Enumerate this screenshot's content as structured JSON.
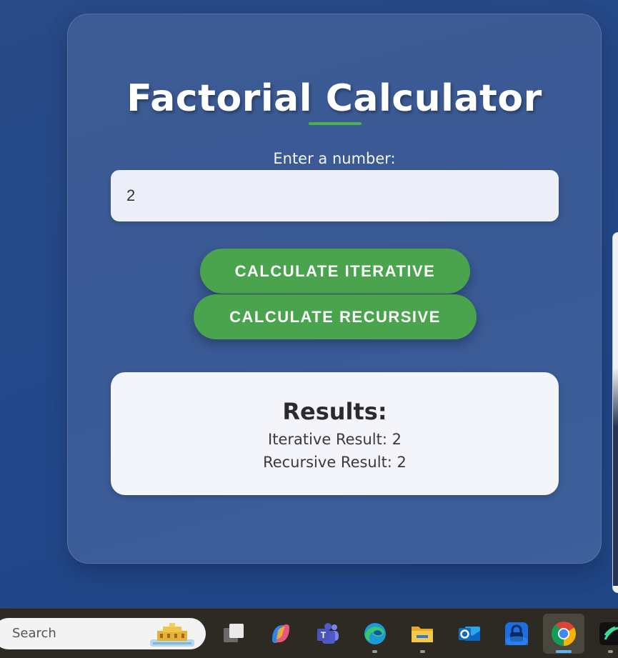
{
  "calculator": {
    "title": "Factorial Calculator",
    "input_label": "Enter a number:",
    "input_value": "2",
    "iterative_button": "CALCULATE ITERATIVE",
    "recursive_button": "CALCULATE RECURSIVE",
    "results_title": "Results:",
    "iterative_result": "Iterative Result: 2",
    "recursive_result": "Recursive Result: 2",
    "accent_color": "#4caf50"
  },
  "taskbar": {
    "search_placeholder": "Search",
    "pinned_apps": [
      {
        "icon": "task-view-icon"
      },
      {
        "icon": "copilot-icon"
      },
      {
        "icon": "teams-icon"
      },
      {
        "icon": "edge-icon"
      },
      {
        "icon": "file-explorer-icon"
      },
      {
        "icon": "outlook-icon"
      },
      {
        "icon": "vpn-lock-icon"
      },
      {
        "icon": "chrome-icon",
        "active": true
      },
      {
        "icon": "app-icon"
      }
    ]
  }
}
